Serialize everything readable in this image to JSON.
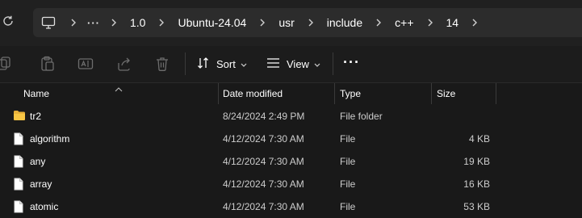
{
  "window": {
    "background": "#191919"
  },
  "address_bar": {
    "refresh_icon": "refresh-icon",
    "computer_icon": "monitor-icon",
    "overflow_label": "···",
    "crumbs": [
      "1.0",
      "Ubuntu-24.04",
      "usr",
      "include",
      "c++",
      "14"
    ]
  },
  "toolbar": {
    "icons": [
      "copy-icon",
      "paste-icon",
      "rename-icon",
      "share-icon",
      "delete-icon"
    ],
    "sort_label": "Sort",
    "view_label": "View",
    "more_label": "···"
  },
  "columns": {
    "name": "Name",
    "date": "Date modified",
    "type": "Type",
    "size": "Size"
  },
  "files": [
    {
      "icon": "folder-icon",
      "name": "tr2",
      "date": "8/24/2024 2:49 PM",
      "type": "File folder",
      "size": ""
    },
    {
      "icon": "file-icon",
      "name": "algorithm",
      "date": "4/12/2024 7:30 AM",
      "type": "File",
      "size": "4 KB"
    },
    {
      "icon": "file-icon",
      "name": "any",
      "date": "4/12/2024 7:30 AM",
      "type": "File",
      "size": "19 KB"
    },
    {
      "icon": "file-icon",
      "name": "array",
      "date": "4/12/2024 7:30 AM",
      "type": "File",
      "size": "16 KB"
    },
    {
      "icon": "file-icon",
      "name": "atomic",
      "date": "4/12/2024 7:30 AM",
      "type": "File",
      "size": "53 KB"
    }
  ]
}
